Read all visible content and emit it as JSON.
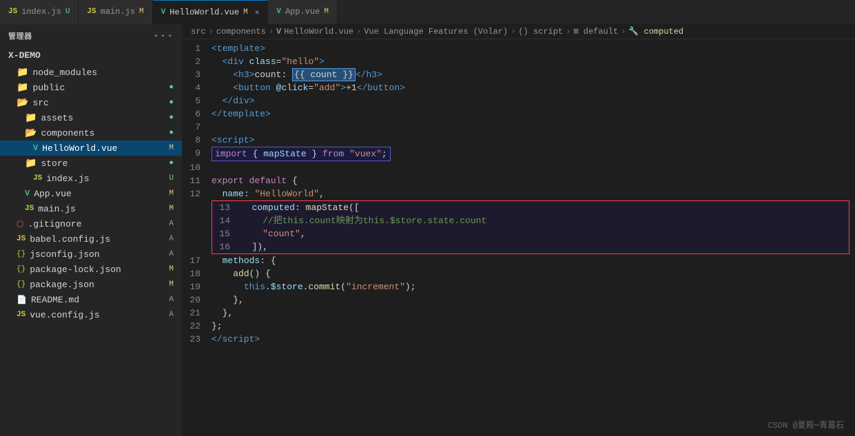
{
  "tabs": [
    {
      "id": "index-js",
      "label": "index.js",
      "type": "js",
      "badge": "U",
      "active": false
    },
    {
      "id": "main-js",
      "label": "main.js",
      "type": "js",
      "badge": "M",
      "active": false
    },
    {
      "id": "hello-world-vue",
      "label": "HelloWorld.vue",
      "type": "vue",
      "badge": "M",
      "active": true,
      "closable": true
    },
    {
      "id": "app-vue",
      "label": "App.vue",
      "type": "vue",
      "badge": "M",
      "active": false
    }
  ],
  "breadcrumb": {
    "parts": [
      "src",
      ">",
      "components",
      ">",
      "HelloWorld.vue",
      ">",
      "Vue Language Features (Volar)",
      ">",
      "() script",
      ">",
      "default",
      ">",
      "computed"
    ]
  },
  "sidebar": {
    "header": "管理器",
    "project": "X-DEMO",
    "items": [
      {
        "label": "node_modules",
        "type": "folder",
        "indent": 1,
        "badge": ""
      },
      {
        "label": "public",
        "type": "folder",
        "indent": 1,
        "badge": "●"
      },
      {
        "label": "src",
        "type": "folder",
        "indent": 1,
        "badge": "●"
      },
      {
        "label": "assets",
        "type": "folder",
        "indent": 2,
        "badge": "●"
      },
      {
        "label": "components",
        "type": "folder",
        "indent": 2,
        "badge": "●"
      },
      {
        "label": "HelloWorld.vue",
        "type": "vue",
        "indent": 3,
        "badge": "M",
        "active": true
      },
      {
        "label": "store",
        "type": "folder",
        "indent": 2,
        "badge": "●"
      },
      {
        "label": "index.js",
        "type": "js",
        "indent": 3,
        "badge": "U"
      },
      {
        "label": "App.vue",
        "type": "vue",
        "indent": 2,
        "badge": "M"
      },
      {
        "label": "main.js",
        "type": "js",
        "indent": 2,
        "badge": "M"
      },
      {
        "label": ".gitignore",
        "type": "git",
        "indent": 1,
        "badge": "A"
      },
      {
        "label": "babel.config.js",
        "type": "js",
        "indent": 1,
        "badge": "A"
      },
      {
        "label": "jsconfig.json",
        "type": "json",
        "indent": 1,
        "badge": "A"
      },
      {
        "label": "package-lock.json",
        "type": "json",
        "indent": 1,
        "badge": "M"
      },
      {
        "label": "package.json",
        "type": "json",
        "indent": 1,
        "badge": "M"
      },
      {
        "label": "README.md",
        "type": "md",
        "indent": 1,
        "badge": "A"
      },
      {
        "label": "vue.config.js",
        "type": "js",
        "indent": 1,
        "badge": "A"
      }
    ]
  },
  "watermark": "CSDN @夏殿⋯青葛石"
}
